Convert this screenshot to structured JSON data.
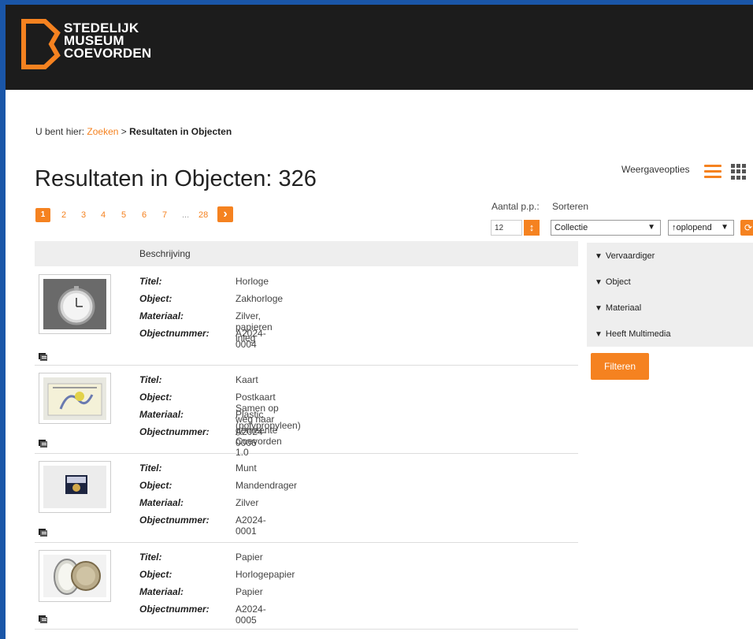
{
  "header": {
    "logo_lines": [
      "STEDELIJK",
      "MUSEUM",
      "COEVORDEN"
    ],
    "brand_color": "#f58220"
  },
  "breadcrumb": {
    "prefix": "U bent hier:",
    "link": "Zoeken",
    "separator": ">",
    "current": "Resultaten in Objecten"
  },
  "title": "Resultaten in Objecten: 326",
  "pagination": {
    "pages": [
      "1",
      "2",
      "3",
      "4",
      "5",
      "6",
      "7",
      "...",
      "28"
    ],
    "active": "1",
    "next_icon": "chevron-right-icon"
  },
  "view_options": {
    "label": "Weergaveopties",
    "list_icon": "list-view-icon",
    "grid_icon": "grid-view-icon"
  },
  "controls": {
    "per_page_label": "Aantal p.p.:",
    "per_page_value": "12",
    "sort_label": "Sorteren",
    "sort_field": "Collectie",
    "sort_order": "↑oplopend"
  },
  "table": {
    "header": "Beschrijving",
    "field_labels": [
      "Titel:",
      "Object:",
      "Materiaal:",
      "Objectnummer:"
    ],
    "rows": [
      {
        "titel": "Horloge",
        "object": "Zakhorloge",
        "materiaal": "Zilver, papieren inleg",
        "objectnummer": "A2024-0004"
      },
      {
        "titel": "Kaart",
        "object": "Postkaart Samen op weg naar gemeente Coevorden 1.0",
        "materiaal": "Plastic (polypropyleen)",
        "objectnummer": "A2024-0006"
      },
      {
        "titel": "Munt",
        "object": "Mandendrager",
        "materiaal": "Zilver",
        "objectnummer": "A2024-0001"
      },
      {
        "titel": "Papier",
        "object": "Horlogepapier",
        "materiaal": "Papier",
        "objectnummer": "A2024-0005"
      }
    ]
  },
  "facets": {
    "items": [
      "Vervaardiger",
      "Object",
      "Materiaal",
      "Heeft Multimedia"
    ],
    "filter_button": "Filteren"
  }
}
